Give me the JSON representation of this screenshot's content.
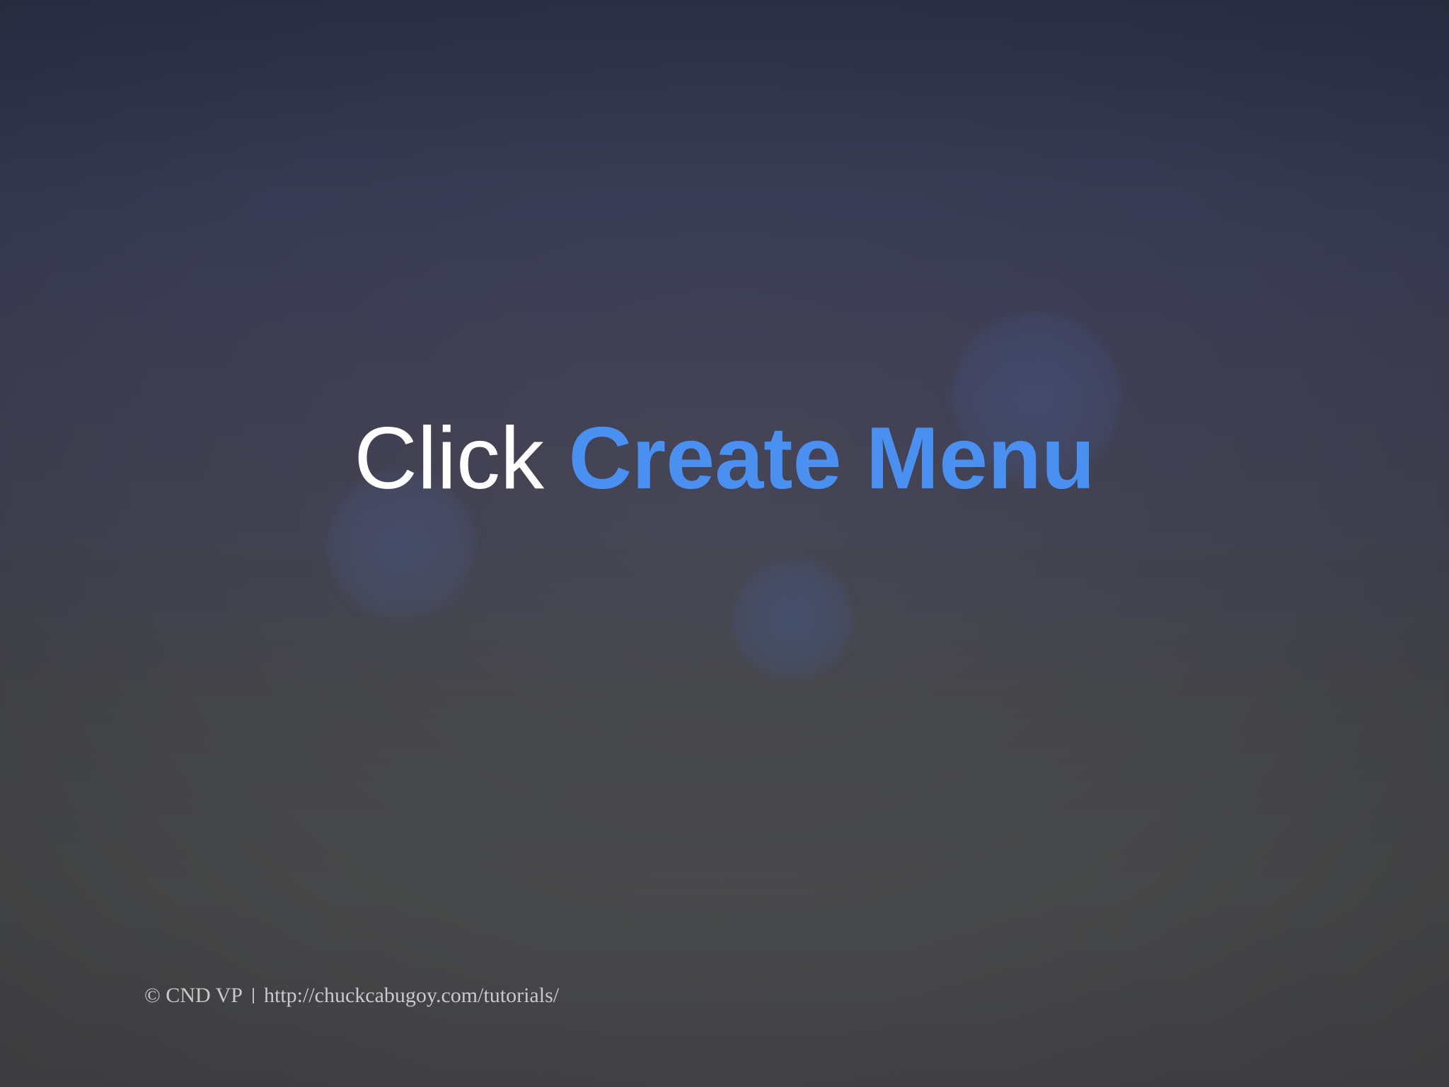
{
  "slide": {
    "headline_prefix": "Click ",
    "headline_highlight": "Create Menu",
    "accent_color": "#4a90f0"
  },
  "footer": {
    "copyright": "© CND VP",
    "url": "http://chuckcabugoy.com/tutorials/"
  }
}
